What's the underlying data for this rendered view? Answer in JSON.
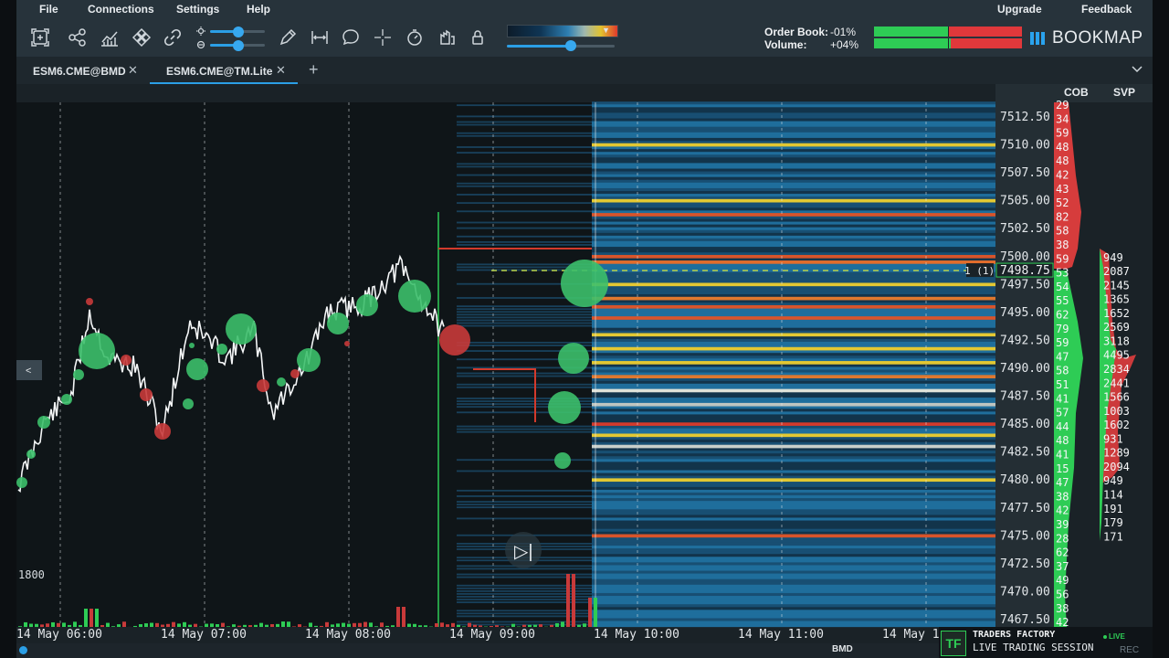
{
  "menu": {
    "items": [
      {
        "label": "File"
      },
      {
        "label": "Connections"
      },
      {
        "label": "Settings"
      },
      {
        "label": "Help"
      }
    ],
    "right": [
      {
        "label": "Upgrade"
      },
      {
        "label": "Feedback"
      }
    ]
  },
  "toolbar": {
    "icons": [
      "zoom-fit-icon",
      "share-icon",
      "chart-icon",
      "move-icon",
      "link-icon",
      "brightness-icon",
      "pencil-icon",
      "measure-icon",
      "chat-icon",
      "crosshair-icon",
      "timer-icon",
      "replay-icon",
      "lock-icon"
    ],
    "order_book_label": "Order Book:",
    "order_book_value": "-01%",
    "volume_label": "Volume:",
    "volume_value": "+04%",
    "order_book_ratio": 0.505,
    "volume_ratio": 0.52,
    "logo_text": "BOOKMAP",
    "colors": {
      "buy": "#2ecc55",
      "sell": "#e0383b",
      "accent": "#2b9fe6"
    }
  },
  "tabs": [
    {
      "label": "ESM6.CME@BMD",
      "active": false
    },
    {
      "label": "ESM6.CME@TM.Lite",
      "active": true
    }
  ],
  "add_tab_label": "+",
  "collapse_label": "<",
  "columns": {
    "cob": "COB",
    "svp": "SVP"
  },
  "chart_data": {
    "type": "heatmap",
    "instrument": "ESM6.CME@TM.Lite",
    "price_ticks": [
      "7512.50",
      "7510.00",
      "7507.50",
      "7505.00",
      "7502.50",
      "7500.00",
      "7497.50",
      "7495.00",
      "7492.50",
      "7490.00",
      "7487.50",
      "7485.00",
      "7482.50",
      "7480.00",
      "7477.50",
      "7475.00",
      "7472.50",
      "7470.00",
      "7467.50"
    ],
    "current_price": "7498.75",
    "current_order_label": "1 (1)",
    "time_ticks": [
      "14 May 06:00",
      "14 May 07:00",
      "14 May 08:00",
      "14 May 09:00",
      "14 May 10:00",
      "14 May 11:00",
      "14 May 1"
    ],
    "volume_axis_label": "1800",
    "cob_values": [
      "29",
      "34",
      "59",
      "48",
      "48",
      "42",
      "43",
      "52",
      "82",
      "58",
      "38",
      "59",
      "53",
      "54",
      "55",
      "62",
      "79",
      "59",
      "47",
      "58",
      "51",
      "41",
      "57",
      "44",
      "48",
      "41",
      "15",
      "47",
      "38",
      "42",
      "39",
      "28",
      "62",
      "37",
      "49",
      "56",
      "38",
      "42"
    ],
    "svp_values": [
      "949",
      "2087",
      "2145",
      "1365",
      "1652",
      "2569",
      "3118",
      "4495",
      "2834",
      "2441",
      "1566",
      "1003",
      "1602",
      "931",
      "1289",
      "2094",
      "949",
      "114",
      "191",
      "179",
      "171"
    ]
  },
  "status": {
    "center_label": "BMD",
    "rec_label": "REC"
  },
  "badge": {
    "logo": "TF",
    "title": "TRADERS FACTORY",
    "subtitle": "LIVE TRADING SESSION",
    "live": "LIVE"
  }
}
